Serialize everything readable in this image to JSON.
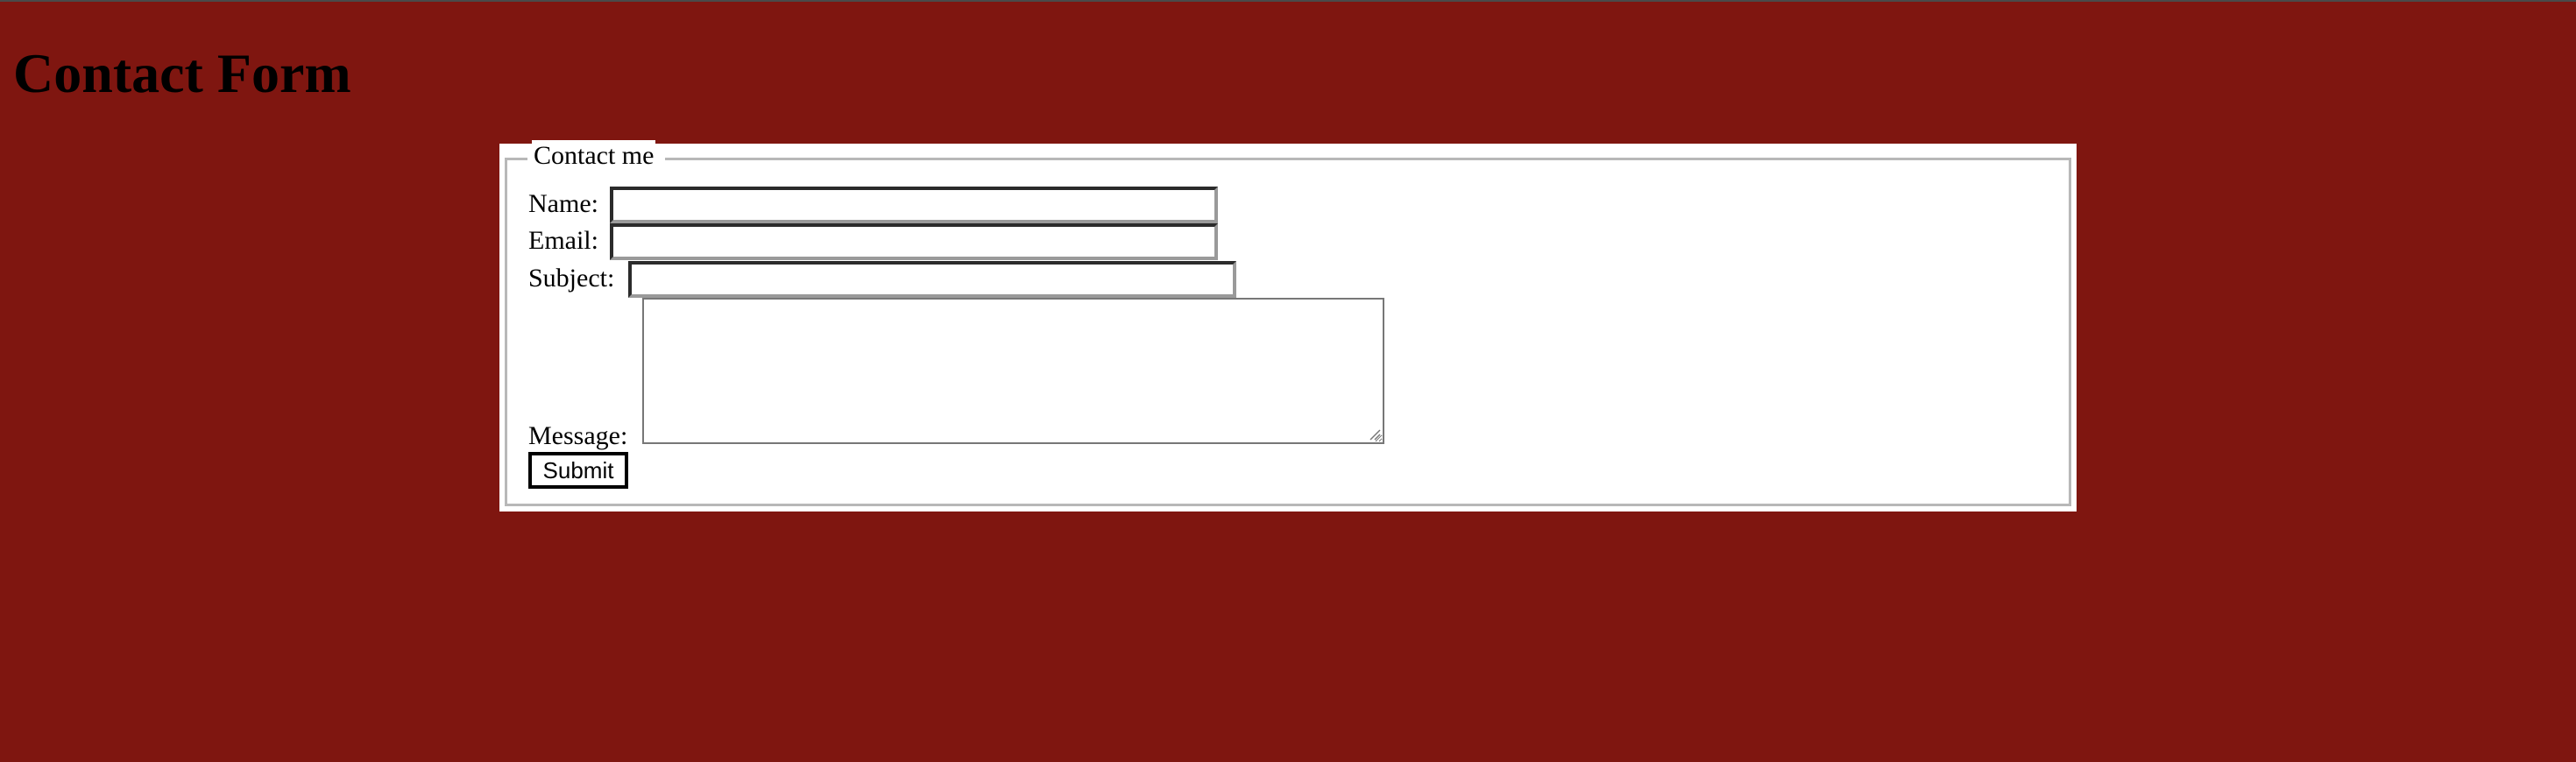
{
  "page": {
    "title": "Contact Form",
    "background_color": "#7f1610"
  },
  "form": {
    "legend": "Contact me",
    "fields": {
      "name": {
        "label": "Name:",
        "value": ""
      },
      "email": {
        "label": "Email:",
        "value": ""
      },
      "subject": {
        "label": "Subject:",
        "value": ""
      },
      "message": {
        "label": "Message:",
        "value": ""
      }
    },
    "submit_label": "Submit"
  }
}
